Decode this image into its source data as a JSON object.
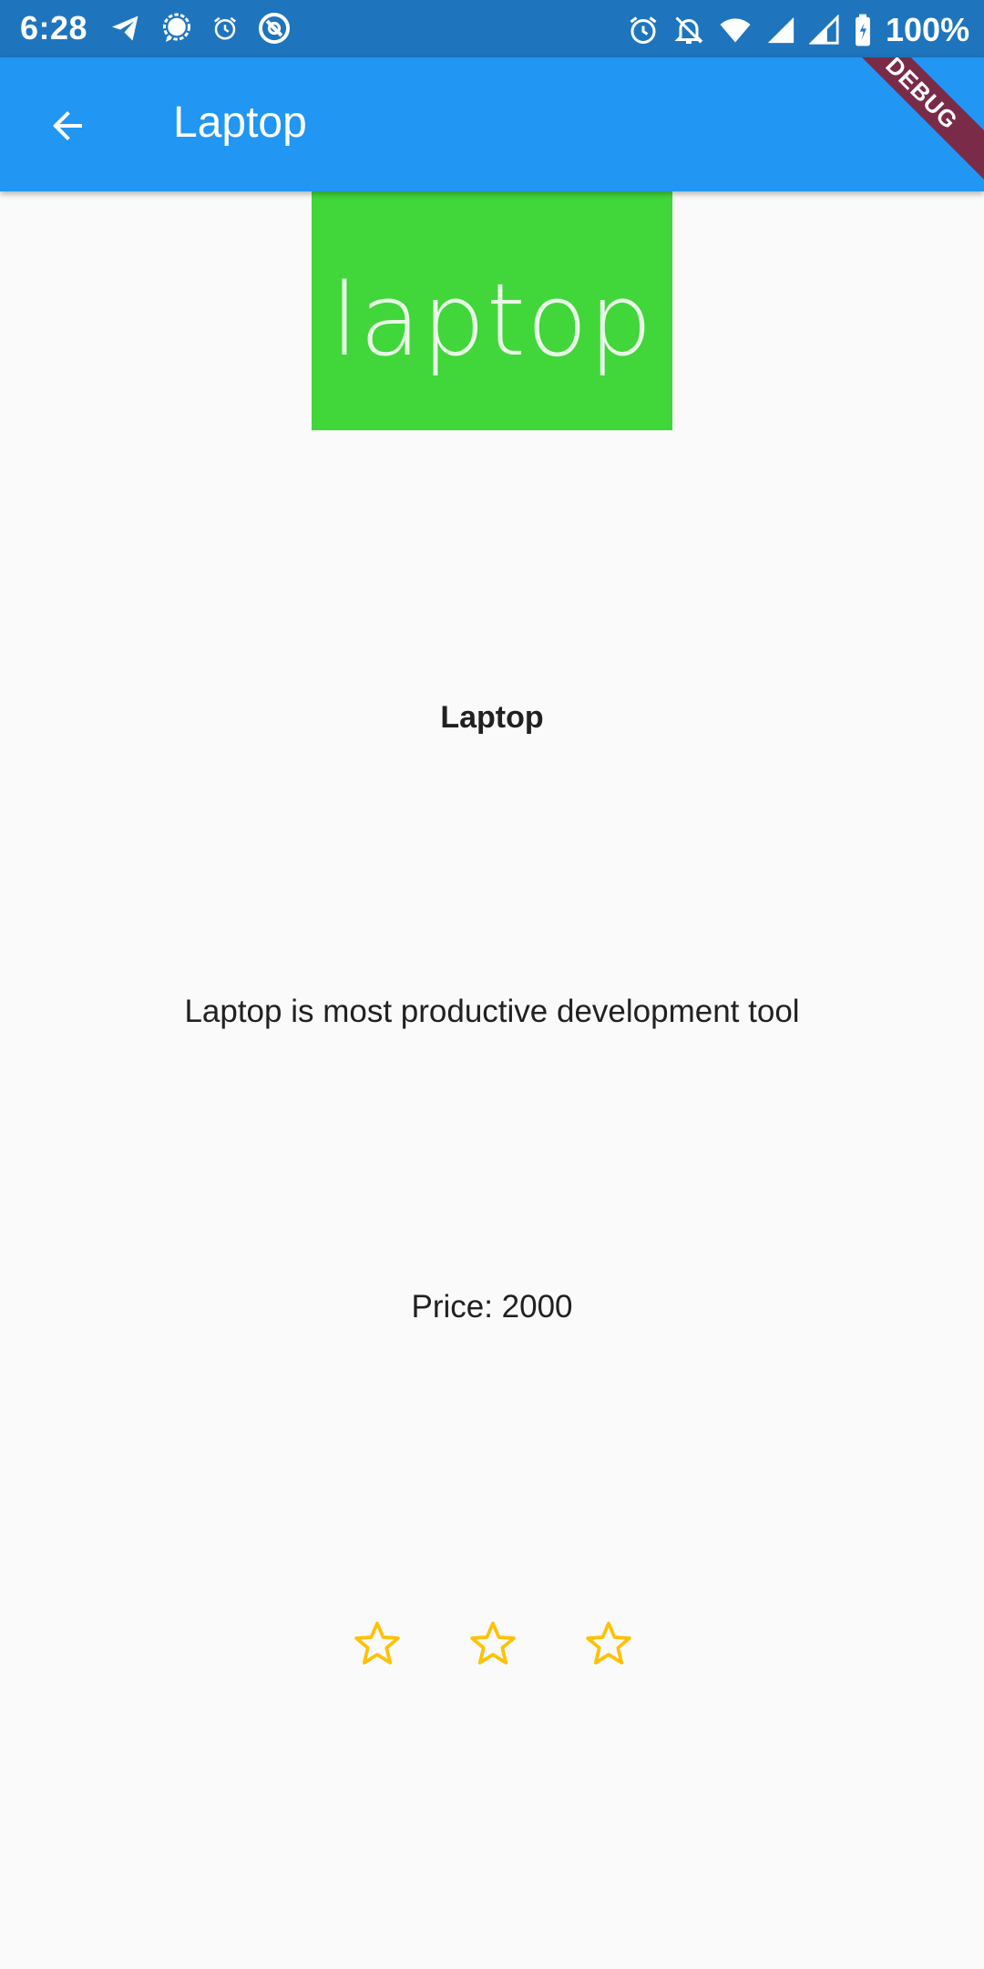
{
  "status_bar": {
    "time": "6:28",
    "battery": "100%",
    "left_icons": [
      "telegram-icon",
      "signal-icon",
      "alarm-small-icon",
      "app-icon"
    ],
    "right_icons": [
      "alarm-icon",
      "notifications-off-icon",
      "wifi-icon",
      "cell-signal-icon",
      "cell-signal-2-icon",
      "battery-icon"
    ]
  },
  "app_bar": {
    "title": "Laptop",
    "background": "#2196F3"
  },
  "debug_banner": "DEBUG",
  "product": {
    "image_text": "laptop",
    "image_color": "#41D63A",
    "name": "Laptop",
    "description": "Laptop is most productive development tool",
    "price": "Price: 2000"
  },
  "rating": {
    "stars": 3,
    "filled": 0,
    "color": "#FFC107"
  }
}
